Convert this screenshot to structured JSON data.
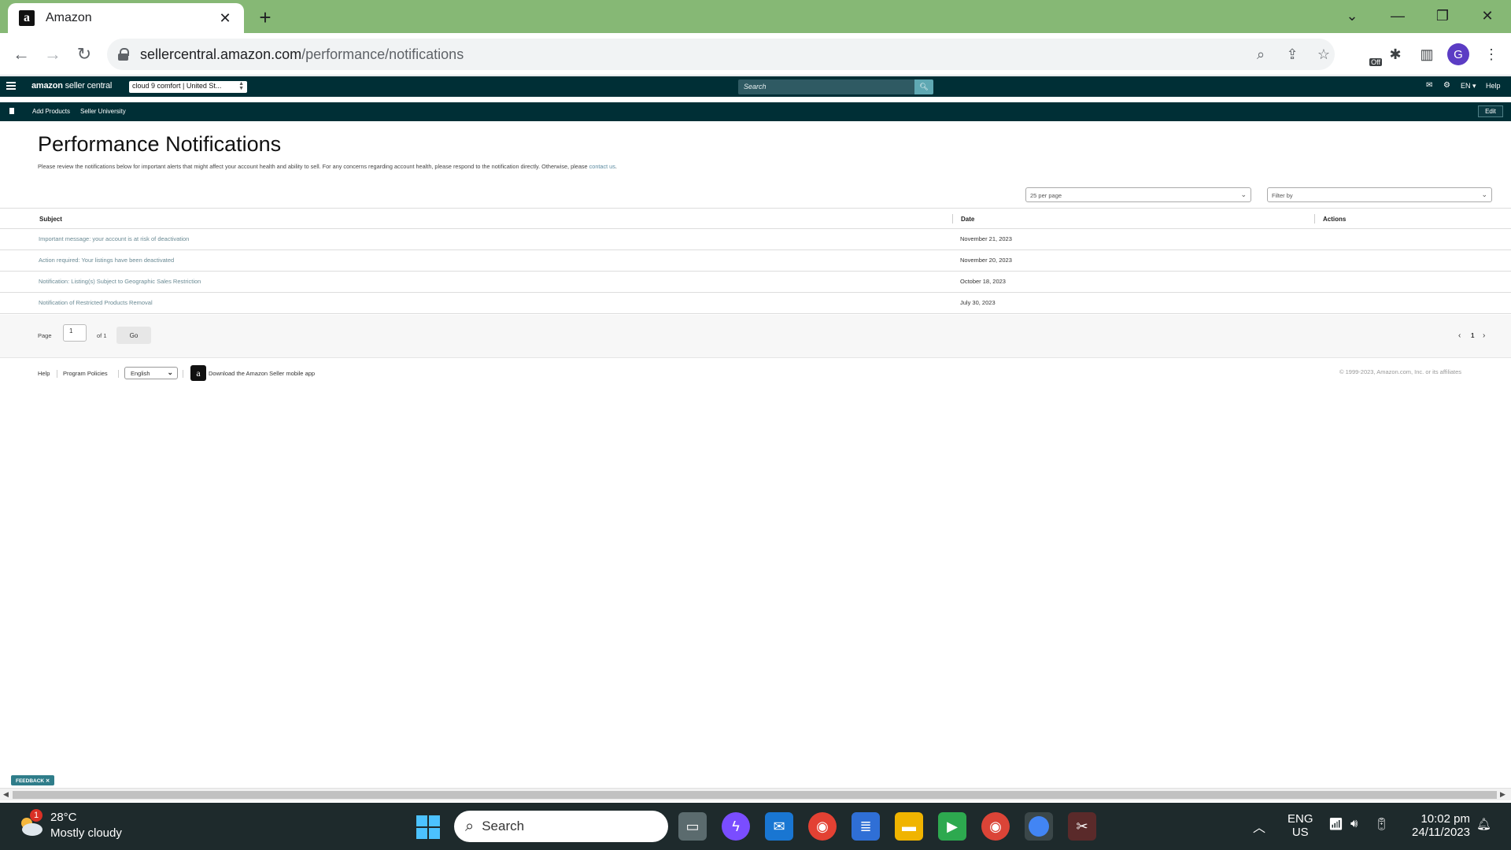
{
  "browser": {
    "tab_title": "Amazon",
    "favicon_letter": "a",
    "url_host": "sellercentral.amazon.com",
    "url_path": "/performance/notifications",
    "extension_badge": "Off",
    "profile_initial": "G"
  },
  "seller_header": {
    "logo_brand": "amazon",
    "logo_suffix": " seller central",
    "store_selector": "cloud 9 comfort | United St...",
    "search_placeholder": "Search",
    "language": "EN",
    "help_label": "Help"
  },
  "seller_nav": {
    "links": [
      "Add Products",
      "Seller University"
    ],
    "edit_label": "Edit"
  },
  "page": {
    "title": "Performance Notifications",
    "description": "Please review the notifications below for important alerts that might affect your account health and ability to sell. For any concerns regarding account health, please respond to the notification directly. Otherwise, please ",
    "description_link": "contact us",
    "description_end": ".",
    "per_page_select": "25 per page",
    "filter_select": "Filter by"
  },
  "table": {
    "columns": [
      "Subject",
      "Date",
      "Actions"
    ],
    "rows": [
      {
        "subject": "Important message: your account is at risk of deactivation",
        "date": "November 21, 2023"
      },
      {
        "subject": "Action required: Your listings have been deactivated",
        "date": "November 20, 2023"
      },
      {
        "subject": "Notification: Listing(s) Subject to Geographic Sales Restriction",
        "date": "October 18, 2023"
      },
      {
        "subject": "Notification of Restricted Products Removal",
        "date": "July 30, 2023"
      }
    ]
  },
  "pagination": {
    "page_label": "Page",
    "page_value": "1",
    "of_label": "of 1",
    "go_label": "Go",
    "current_page": "1"
  },
  "footer": {
    "help": "Help",
    "program_policies": "Program Policies",
    "language": "English",
    "app_link": "Download the Amazon Seller mobile app",
    "copyright": "© 1999-2023, Amazon.com, Inc. or its affiliates"
  },
  "feedback_label": "FEEDBACK",
  "taskbar": {
    "weather_badge": "1",
    "temperature": "28°C",
    "weather": "Mostly cloudy",
    "search_label": "Search",
    "lang_line1": "ENG",
    "lang_line2": "US",
    "time": "10:02 pm",
    "date": "24/11/2023"
  },
  "colors": {
    "tab_strip": "#86b875",
    "seller_header": "#002f36",
    "link": "#6a8a94"
  }
}
